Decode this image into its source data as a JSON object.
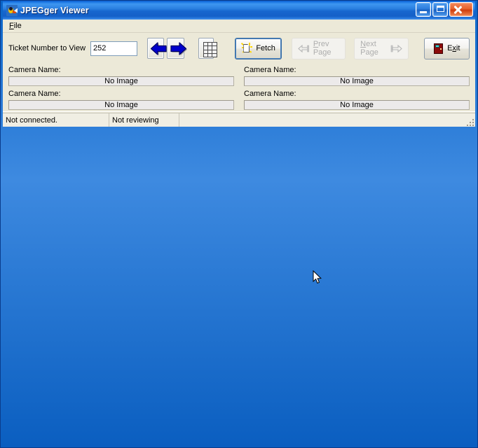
{
  "window": {
    "title": "JPEGger Viewer",
    "icon": "diver-icon",
    "controls": {
      "minimize": "Minimize",
      "maximize": "Maximize",
      "close": "Close"
    }
  },
  "menu": {
    "items": [
      {
        "label": "File",
        "accel": "F"
      }
    ]
  },
  "toolbar": {
    "ticket_label": "Ticket Number to View",
    "ticket_value": "252",
    "ticket_placeholder": "",
    "prev_arrow_name": "left-arrow-icon",
    "next_arrow_name": "right-arrow-icon",
    "keypad_name": "keypad-icon",
    "buttons": [
      {
        "label": "Fetch",
        "accel": "",
        "icon": "new-document-icon",
        "disabled": false,
        "default": true
      },
      {
        "label": "Prev Page",
        "accel": "P",
        "icon": "hand-left-icon",
        "disabled": true,
        "default": false
      },
      {
        "label": "Next Page",
        "accel": "N",
        "icon": "hand-right-icon",
        "disabled": true,
        "default": false
      },
      {
        "label": "Exit",
        "accel": "x",
        "icon": "door-icon",
        "disabled": false,
        "default": false
      }
    ],
    "fetch_label": "Fetch",
    "prev_label_a": "P",
    "prev_label_b": "rev Page",
    "next_label_a": "N",
    "next_label_b": "ext Page",
    "exit_label_a": "E",
    "exit_label_b": "x",
    "exit_label_c": "it"
  },
  "panels": [
    {
      "label": "Camera Name:",
      "content": "No Image"
    },
    {
      "label": "Camera Name:",
      "content": "No Image"
    },
    {
      "label": "Camera Name:",
      "content": "No Image"
    },
    {
      "label": "Camera Name:",
      "content": "No Image"
    }
  ],
  "statusbar": {
    "connection": "Not connected.",
    "review": "Not reviewing",
    "extra": ""
  },
  "colors": {
    "title_accent": "#1f7ae6",
    "close_button": "#e8622c",
    "arrow_blue": "#0000cc",
    "face": "#ece9d8",
    "panel_bg": "#eceaea",
    "default_focus": "#3a6ea5",
    "door_red": "#8b0a0a"
  }
}
